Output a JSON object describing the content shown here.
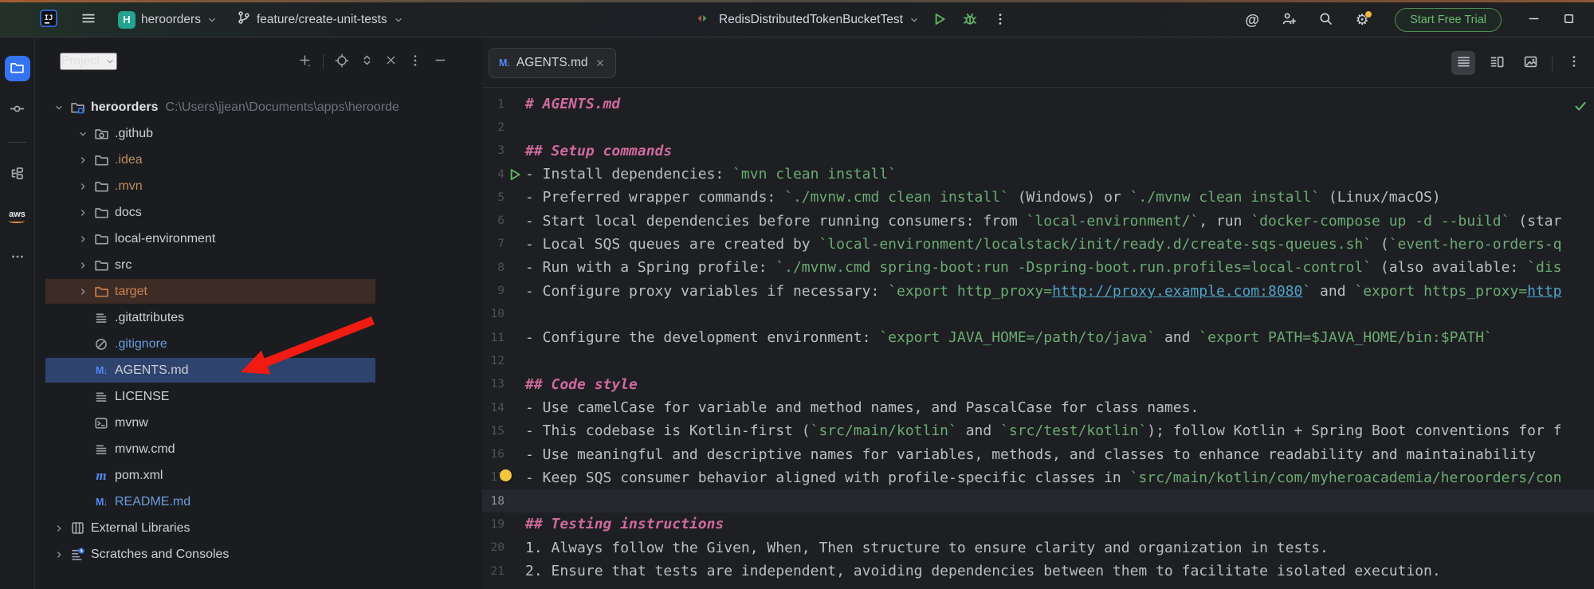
{
  "topbar": {
    "app_icon": "intellij-logo",
    "menu_icon": "hamburger",
    "project": {
      "badge": "H",
      "name": "heroorders"
    },
    "branch": {
      "icon": "git-branch",
      "name": "feature/create-unit-tests"
    },
    "run": {
      "config_icon": "run-configs",
      "name": "RedisDistributedTokenBucketTest",
      "actions": [
        "run",
        "debug",
        "more-vertical"
      ]
    },
    "right_icons": [
      "ai-assistant",
      "code-with-me",
      "search",
      "settings"
    ],
    "settings_has_notification": true,
    "trial_button": "Start Free Trial",
    "window_buttons": [
      "minimize",
      "maximize"
    ],
    "accent_colors": {
      "run_green": "#5fb865",
      "badge_teal": "#24a38f",
      "trial_green": "#68ba70"
    }
  },
  "toolstrip": {
    "icons": [
      {
        "name": "project",
        "active": true
      },
      {
        "name": "commit",
        "active": false
      },
      {
        "name": "divider"
      },
      {
        "name": "structure",
        "active": false
      },
      {
        "name": "aws",
        "active": false
      },
      {
        "name": "more-horizontal",
        "active": false
      }
    ]
  },
  "project_panel": {
    "title": "Project",
    "header_icons": [
      "plus",
      "locate",
      "expand-all",
      "collapse-all",
      "more-vertical",
      "hide"
    ],
    "tree": [
      {
        "label": "heroorders",
        "path": "C:\\Users\\jjean\\Documents\\apps\\heroorde",
        "icon": "project-folder",
        "level": 0,
        "chevron": "down",
        "bold": true
      },
      {
        "label": ".github",
        "icon": "github-folder",
        "level": 1,
        "chevron": "down"
      },
      {
        "label": ".idea",
        "icon": "folder",
        "level": 1,
        "chevron": "right",
        "state": "ignored"
      },
      {
        "label": ".mvn",
        "icon": "folder",
        "level": 1,
        "chevron": "right",
        "state": "ignored"
      },
      {
        "label": "docs",
        "icon": "folder",
        "level": 1,
        "chevron": "right"
      },
      {
        "label": "local-environment",
        "icon": "folder",
        "level": 1,
        "chevron": "right"
      },
      {
        "label": "src",
        "icon": "folder",
        "level": 1,
        "chevron": "right"
      },
      {
        "label": "target",
        "icon": "folder",
        "level": 1,
        "chevron": "right",
        "state": "excluded",
        "row": "target"
      },
      {
        "label": ".gitattributes",
        "icon": "text-file",
        "level": 1
      },
      {
        "label": ".gitignore",
        "icon": "ignore-file",
        "level": 1,
        "state": "modified"
      },
      {
        "label": "AGENTS.md",
        "icon": "markdown-file",
        "level": 1,
        "row": "selected"
      },
      {
        "label": "LICENSE",
        "icon": "text-file",
        "level": 1
      },
      {
        "label": "mvnw",
        "icon": "shell-file",
        "level": 1
      },
      {
        "label": "mvnw.cmd",
        "icon": "text-file",
        "level": 1
      },
      {
        "label": "pom.xml",
        "icon": "maven-file",
        "level": 1
      },
      {
        "label": "README.md",
        "icon": "markdown-file",
        "level": 1,
        "state": "modified"
      },
      {
        "label": "External Libraries",
        "icon": "libraries",
        "level": 0,
        "chevron": "right"
      },
      {
        "label": "Scratches and Consoles",
        "icon": "scratches",
        "level": 0,
        "chevron": "right"
      }
    ],
    "state_colors": {
      "ignored": "#bb8f60",
      "modified": "#6a9ede",
      "excluded": "#c8824f",
      "selected_row": "#2e436e",
      "target_row": "#3d2c25"
    }
  },
  "editor": {
    "tab": {
      "label": "AGENTS.md",
      "icon": "markdown-file",
      "close_icon": "close"
    },
    "view_icons": [
      "editor-only",
      "split-view",
      "preview"
    ],
    "view_active": "editor-only",
    "more_icon": "more-vertical",
    "inspection_icon": "check",
    "lines": [
      {
        "n": 1,
        "seg": [
          [
            "h",
            "# AGENTS.md"
          ]
        ]
      },
      {
        "n": 2,
        "seg": []
      },
      {
        "n": 3,
        "seg": [
          [
            "h",
            "## Setup commands"
          ]
        ]
      },
      {
        "n": 4,
        "run": true,
        "seg": [
          [
            "t",
            "- Install dependencies: "
          ],
          [
            "c",
            "`mvn clean install`"
          ]
        ]
      },
      {
        "n": 5,
        "seg": [
          [
            "t",
            "- Preferred wrapper commands: "
          ],
          [
            "c",
            "`./mvnw.cmd clean install`"
          ],
          [
            "t",
            " (Windows) or "
          ],
          [
            "c",
            "`./mvnw clean install`"
          ],
          [
            "t",
            " (Linux/macOS)"
          ]
        ]
      },
      {
        "n": 6,
        "seg": [
          [
            "t",
            "- Start local dependencies before running consumers: from "
          ],
          [
            "c",
            "`local-environment/`"
          ],
          [
            "t",
            ", run "
          ],
          [
            "c",
            "`docker-compose up -d --build`"
          ],
          [
            "t",
            " (star"
          ]
        ]
      },
      {
        "n": 7,
        "seg": [
          [
            "t",
            "- Local SQS queues are created by "
          ],
          [
            "c",
            "`local-environment/localstack/init/ready.d/create-sqs-queues.sh`"
          ],
          [
            "t",
            " ("
          ],
          [
            "c",
            "`event-hero-orders-q"
          ]
        ]
      },
      {
        "n": 8,
        "seg": [
          [
            "t",
            "- Run with a Spring profile: "
          ],
          [
            "c",
            "`./mvnw.cmd spring-boot:run -Dspring-boot.run.profiles=local-control`"
          ],
          [
            "t",
            " (also available: "
          ],
          [
            "c",
            "`dis"
          ]
        ]
      },
      {
        "n": 9,
        "seg": [
          [
            "t",
            "- Configure proxy variables if necessary: "
          ],
          [
            "c",
            "`export http_proxy="
          ],
          [
            "l",
            "http://proxy.example.com:8080"
          ],
          [
            "c",
            "`"
          ],
          [
            "t",
            " and "
          ],
          [
            "c",
            "`export https_proxy="
          ],
          [
            "l",
            "http"
          ]
        ]
      },
      {
        "n": 10,
        "seg": []
      },
      {
        "n": 11,
        "seg": [
          [
            "t",
            "- Configure the development environment: "
          ],
          [
            "c",
            "`export JAVA_HOME=/path/to/java`"
          ],
          [
            "t",
            " and "
          ],
          [
            "c",
            "`export PATH=$JAVA_HOME/bin:$PATH`"
          ]
        ]
      },
      {
        "n": 12,
        "seg": []
      },
      {
        "n": 13,
        "seg": [
          [
            "h",
            "## Code style"
          ]
        ]
      },
      {
        "n": 14,
        "seg": [
          [
            "t",
            "- Use camelCase for variable and method names, and PascalCase for class names."
          ]
        ]
      },
      {
        "n": 15,
        "seg": [
          [
            "t",
            "- This codebase is Kotlin-first ("
          ],
          [
            "c",
            "`src/main/kotlin`"
          ],
          [
            "t",
            " and "
          ],
          [
            "c",
            "`src/test/kotlin`"
          ],
          [
            "t",
            "); follow Kotlin + Spring Boot conventions for f"
          ]
        ]
      },
      {
        "n": 16,
        "seg": [
          [
            "t",
            "- Use meaningful and descriptive names for variables, methods, and classes to enhance readability and maintainability"
          ]
        ]
      },
      {
        "n": 17,
        "bulb": true,
        "seg": [
          [
            "t",
            "- Keep SQS consumer behavior aligned with profile-specific classes in "
          ],
          [
            "c",
            "`src/main/kotlin/com/myheroacademia/heroorders/con"
          ]
        ]
      },
      {
        "n": 18,
        "caret": true,
        "seg": []
      },
      {
        "n": 19,
        "seg": [
          [
            "h",
            "## Testing instructions"
          ]
        ]
      },
      {
        "n": 20,
        "seg": [
          [
            "t",
            "1. Always follow the Given, When, Then structure to ensure clarity and organization in tests."
          ]
        ]
      },
      {
        "n": 21,
        "seg": [
          [
            "t",
            "2. Ensure that tests are independent, avoiding dependencies between them to facilitate isolated execution."
          ]
        ]
      }
    ],
    "syntax_colors": {
      "heading": "#cf6a9e",
      "code": "#6aab73",
      "link": "#4fa3c9",
      "text": "#bcbec4"
    }
  },
  "annotation": {
    "shape": "arrow",
    "color": "#f01b12",
    "points_to": "AGENTS.md tree row"
  }
}
